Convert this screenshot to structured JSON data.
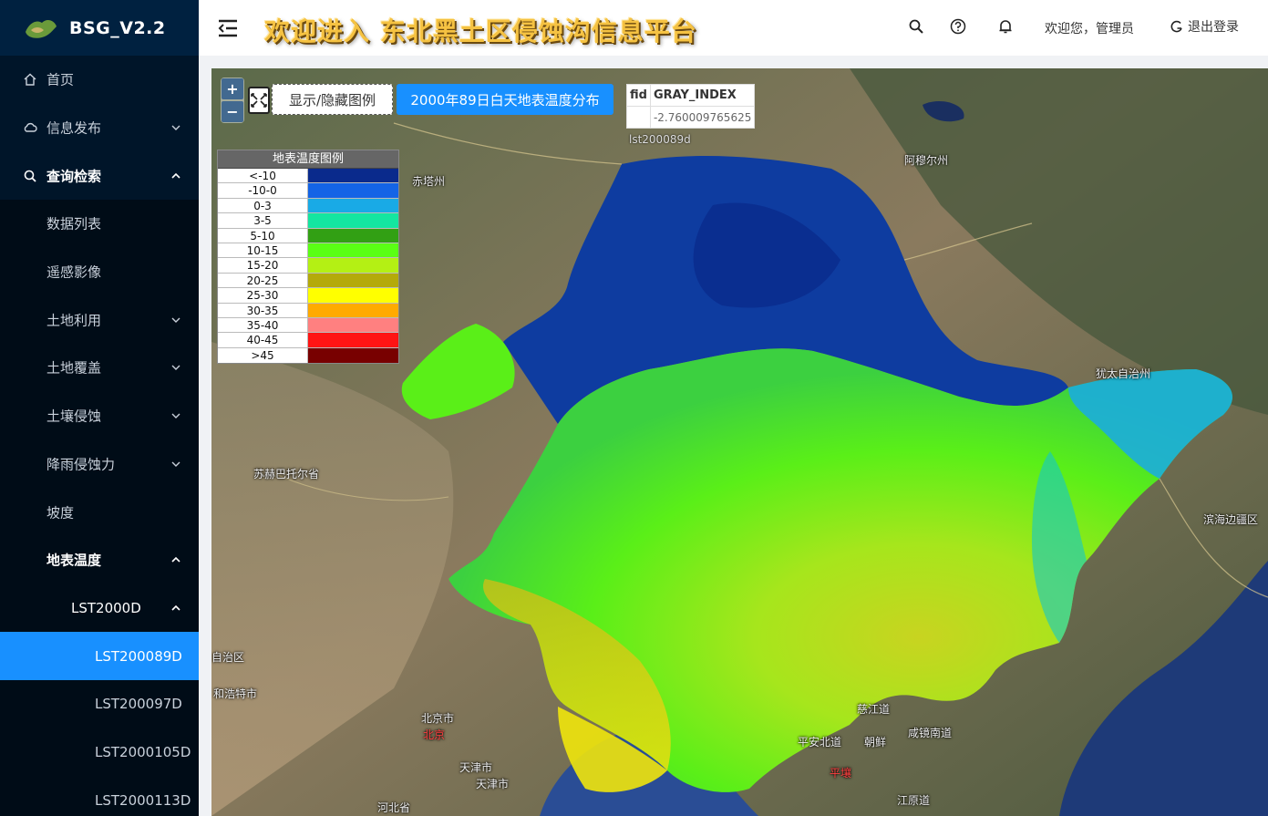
{
  "brand": {
    "title": "BSG_V2.2"
  },
  "header": {
    "site_title": "欢迎进入 东北黑土区侵蚀沟信息平台",
    "welcome_text": "欢迎您，管理员",
    "logout_label": "退出登录",
    "icons": [
      "search-icon",
      "question-icon",
      "bell-icon"
    ]
  },
  "sidebar": {
    "items": [
      {
        "label": "首页",
        "icon": "home-icon"
      },
      {
        "label": "信息发布",
        "icon": "cloud-icon"
      },
      {
        "label": "查询检索",
        "icon": "search-icon"
      },
      {
        "label": "数据列表"
      },
      {
        "label": "遥感影像"
      },
      {
        "label": "土地利用"
      },
      {
        "label": "土地覆盖"
      },
      {
        "label": "土壤侵蚀"
      },
      {
        "label": "降雨侵蚀力"
      },
      {
        "label": "坡度"
      },
      {
        "label": "地表温度"
      },
      {
        "label": "LST2000D"
      },
      {
        "label": "LST200089D"
      },
      {
        "label": "LST200097D"
      },
      {
        "label": "LST2000105D"
      },
      {
        "label": "LST2000113D"
      }
    ]
  },
  "map": {
    "zoom_in": "+",
    "zoom_out": "−",
    "legend_toggle_label": "显示/隐藏图例",
    "layer_button_label": "2000年89日白天地表温度分布",
    "info": {
      "col1": "fid",
      "col2": "GRAY_INDEX",
      "fid_value": "",
      "gray_value": "-2.760009765625",
      "layer_name": "lst200089d"
    },
    "legend": {
      "title": "地表温度图例",
      "rows": [
        {
          "label": "<-10",
          "color": "#0a2a8c"
        },
        {
          "label": "-10-0",
          "color": "#1464e6"
        },
        {
          "label": "0-3",
          "color": "#19aae6"
        },
        {
          "label": "3-5",
          "color": "#14e6a0"
        },
        {
          "label": "5-10",
          "color": "#32a014"
        },
        {
          "label": "10-15",
          "color": "#5aff14"
        },
        {
          "label": "15-20",
          "color": "#b4f014"
        },
        {
          "label": "20-25",
          "color": "#b4aa0a"
        },
        {
          "label": "25-30",
          "color": "#ffff00"
        },
        {
          "label": "30-35",
          "color": "#ffaa00"
        },
        {
          "label": "35-40",
          "color": "#ff8080"
        },
        {
          "label": "40-45",
          "color": "#ff1414"
        },
        {
          "label": ">45",
          "color": "#780000"
        }
      ]
    },
    "places": {
      "p1": "赤塔州",
      "p2": "阿穆尔州",
      "p3": "犹太自治州",
      "p4": "苏赫巴托尔省",
      "p5": "滨海边疆区",
      "p6": "自治区",
      "p7": "和浩特市",
      "p8": "北京市",
      "p9": "北京",
      "p10": "天津市",
      "p11": "天津市",
      "p12": "河北省",
      "p13": "慈江道",
      "p14": "平安北道",
      "p15": "朝鲜",
      "p16": "咸镜南道",
      "p17": "平壤",
      "p18": "江原道"
    }
  }
}
